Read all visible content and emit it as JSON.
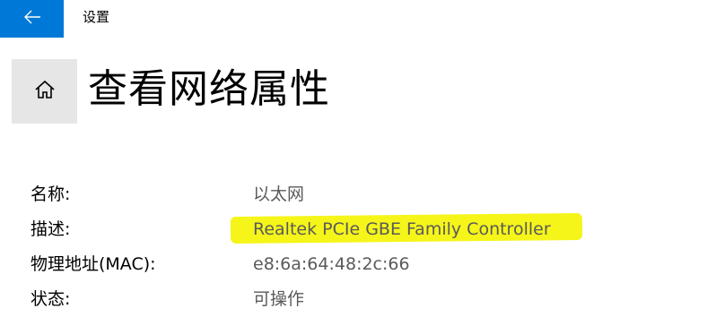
{
  "header": {
    "app_title": "设置",
    "back_icon": "arrow-left-icon",
    "accent_color": "#0078d7"
  },
  "page": {
    "home_icon": "home-icon",
    "title": "查看网络属性"
  },
  "properties": [
    {
      "label": "名称:",
      "value": "以太网"
    },
    {
      "label": "描述:",
      "value": "Realtek PCIe GBE Family Controller",
      "highlighted": true,
      "highlight_color": "#f5f51a"
    },
    {
      "label": "物理地址(MAC):",
      "value": "e8:6a:64:48:2c:66"
    },
    {
      "label": "状态:",
      "value": "可操作"
    }
  ]
}
